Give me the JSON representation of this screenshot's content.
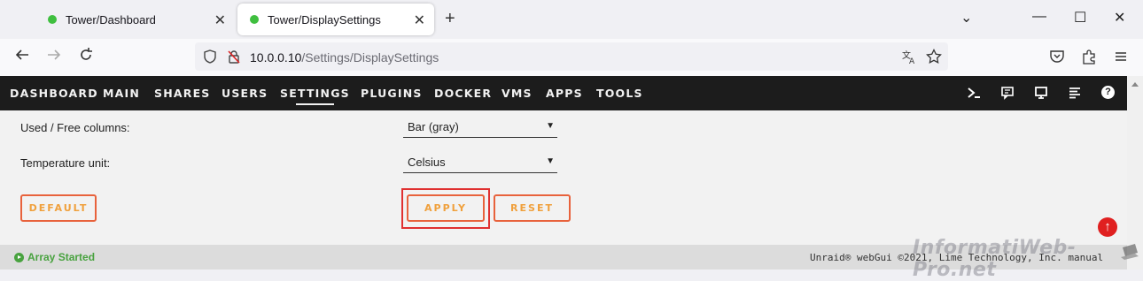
{
  "browser": {
    "tabs": [
      {
        "title": "Tower/Dashboard",
        "active": false
      },
      {
        "title": "Tower/DisplaySettings",
        "active": true
      }
    ],
    "url_host": "10.0.0.10",
    "url_path": "/Settings/DisplaySettings",
    "close_glyph": "✕",
    "newtab_glyph": "+",
    "minimize_glyph": "—",
    "maximize_glyph": "☐",
    "window_close_glyph": "✕",
    "chevron_glyph": "⌄"
  },
  "menu": {
    "items": [
      "DASHBOARD",
      "MAIN",
      "SHARES",
      "USERS",
      "SETTINGS",
      "PLUGINS",
      "DOCKER",
      "VMS",
      "APPS",
      "TOOLS"
    ],
    "active": "SETTINGS",
    "icons": [
      "terminal-icon",
      "feedback-icon",
      "monitor-icon",
      "log-icon",
      "help-icon"
    ]
  },
  "settings": {
    "used_free_label": "Used / Free columns:",
    "used_free_value": "Bar (gray)",
    "temp_label": "Temperature unit:",
    "temp_value": "Celsius"
  },
  "buttons": {
    "default": "DEFAULT",
    "apply": "APPLY",
    "reset": "RESET"
  },
  "footer": {
    "status": "Array Started",
    "copyright": "Unraid® webGui ©2021, Lime Technology, Inc. manual"
  },
  "watermark": "InformatiWeb-Pro.net",
  "colors": {
    "accent_orange": "#e8623c",
    "button_text": "#f0a03c",
    "status_green": "#48a23f",
    "menu_bg": "#1c1c1c"
  }
}
